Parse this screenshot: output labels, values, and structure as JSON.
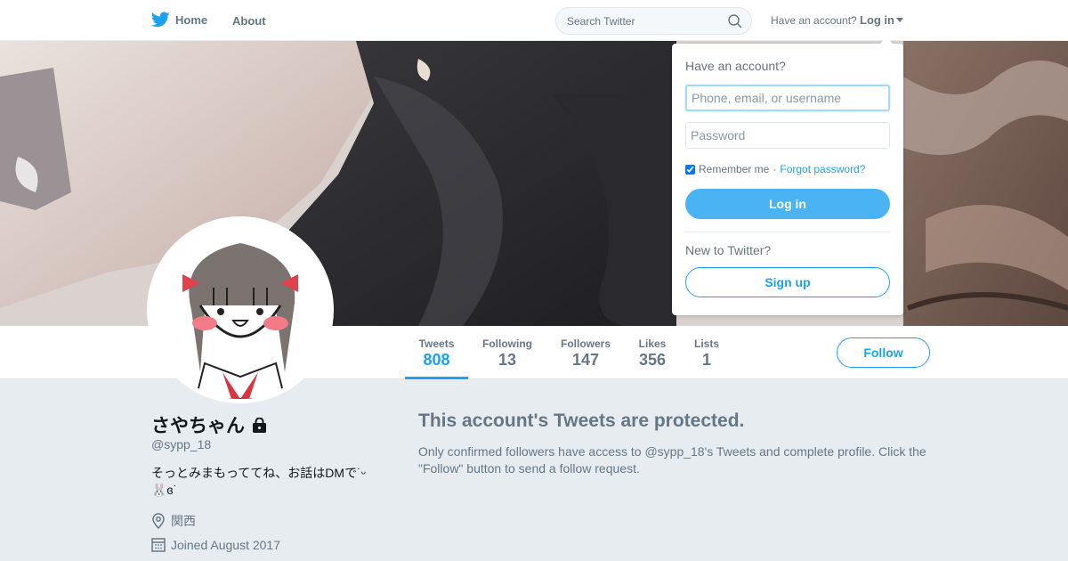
{
  "nav": {
    "home_label": "Home",
    "about_label": "About",
    "search_placeholder": "Search Twitter",
    "have_account": "Have an account?",
    "login_label": "Log in"
  },
  "colors": {
    "brand_blue": "#1da1f2",
    "text_gray": "#657786",
    "background": "#e6ecf0"
  },
  "icons": {
    "logo": "twitter-bird-icon",
    "search": "magnifier-icon",
    "caret": "caret-down-icon",
    "lock": "lock-icon",
    "location": "location-pin-icon",
    "calendar": "calendar-icon"
  },
  "stats": [
    {
      "label": "Tweets",
      "value": "808",
      "active": true
    },
    {
      "label": "Following",
      "value": "13",
      "active": false
    },
    {
      "label": "Followers",
      "value": "147",
      "active": false
    },
    {
      "label": "Likes",
      "value": "356",
      "active": false
    },
    {
      "label": "Lists",
      "value": "1",
      "active": false
    }
  ],
  "follow_label": "Follow",
  "profile": {
    "name": "さやちゃん",
    "handle": "@sypp_18",
    "bio": "そっとみまもっててね、お話はDMで˙ᵕ 🐰ɞ˙",
    "location": "関西",
    "joined": "Joined August 2017"
  },
  "protected": {
    "title": "This account's Tweets are protected.",
    "text": "Only confirmed followers have access to @sypp_18's Tweets and complete profile. Click the \"Follow\" button to send a follow request."
  },
  "login_dropdown": {
    "heading": "Have an account?",
    "username_placeholder": "Phone, email, or username",
    "password_placeholder": "Password",
    "remember_label": "Remember me",
    "separator": "·",
    "forgot_label": "Forgot password?",
    "login_button": "Log in",
    "new_to": "New to Twitter?",
    "signup_button": "Sign up"
  }
}
